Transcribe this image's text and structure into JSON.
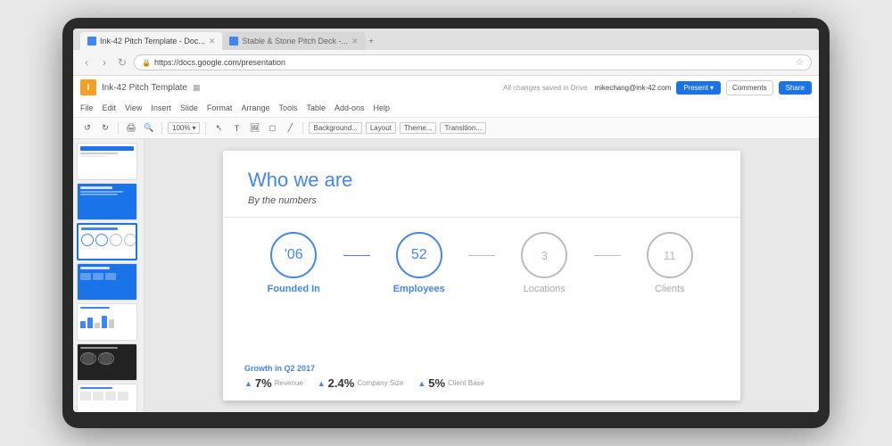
{
  "device": {
    "type": "tablet-laptop"
  },
  "browser": {
    "tabs": [
      {
        "label": "Ink-42 Pitch Template - Doc...",
        "active": true,
        "favicon": "blue"
      },
      {
        "label": "Stable & Stone Pitch Deck -...",
        "active": false,
        "favicon": "blue"
      }
    ],
    "address": "https://docs.google.com/presentation",
    "star": "☆"
  },
  "app": {
    "logo": "I",
    "title": "Ink-42 Pitch Template",
    "drive_icon": "▦",
    "autosave": "All changes saved in Drive",
    "user_email": "mikechang@ink-42.com",
    "present_btn": "Present",
    "comments_btn": "Comments",
    "share_btn": "Share",
    "menu_items": [
      "File",
      "Edit",
      "View",
      "Insert",
      "Slide",
      "Format",
      "Arrange",
      "Tools",
      "Table",
      "Add-ons",
      "Help"
    ],
    "toolbar_items": [
      "←",
      "→",
      "↺",
      "↻",
      "|",
      "🔍",
      "+",
      "-",
      "100%",
      "|",
      "T",
      "🖼",
      "📐",
      "✏",
      "▶",
      "⬜",
      "○",
      "|",
      "Background...",
      "Layout",
      "Theme...",
      "Transition..."
    ]
  },
  "slides_panel": {
    "slides": [
      {
        "id": 1,
        "theme": "white-blue"
      },
      {
        "id": 2,
        "theme": "blue"
      },
      {
        "id": 3,
        "theme": "white",
        "active": true
      },
      {
        "id": 4,
        "theme": "blue"
      },
      {
        "id": 5,
        "theme": "white"
      },
      {
        "id": 6,
        "theme": "dark"
      },
      {
        "id": 7,
        "theme": "white"
      }
    ]
  },
  "slide": {
    "title": "Who we are",
    "subtitle": "By the numbers",
    "stats": [
      {
        "id": "founded",
        "circle_text": "'06",
        "label": "Founded In",
        "active": true,
        "connector_after": true,
        "connector_active": true
      },
      {
        "id": "employees",
        "circle_text": "52",
        "label": "Employees",
        "active": true,
        "connector_after": true,
        "connector_active": false
      },
      {
        "id": "locations",
        "circle_text": "3",
        "label": "Locations",
        "active": false,
        "connector_after": true,
        "connector_active": false
      },
      {
        "id": "clients",
        "circle_text": "11",
        "label": "Clients",
        "active": false,
        "connector_after": false
      }
    ],
    "growth": {
      "title": "Growth in Q2 2017",
      "items": [
        {
          "arrow": "▲",
          "value": "7%",
          "label": "Revenue"
        },
        {
          "arrow": "▲",
          "value": "2.4%",
          "label": "Company Size"
        },
        {
          "arrow": "▲",
          "value": "5%",
          "label": "Client Base"
        }
      ]
    }
  }
}
